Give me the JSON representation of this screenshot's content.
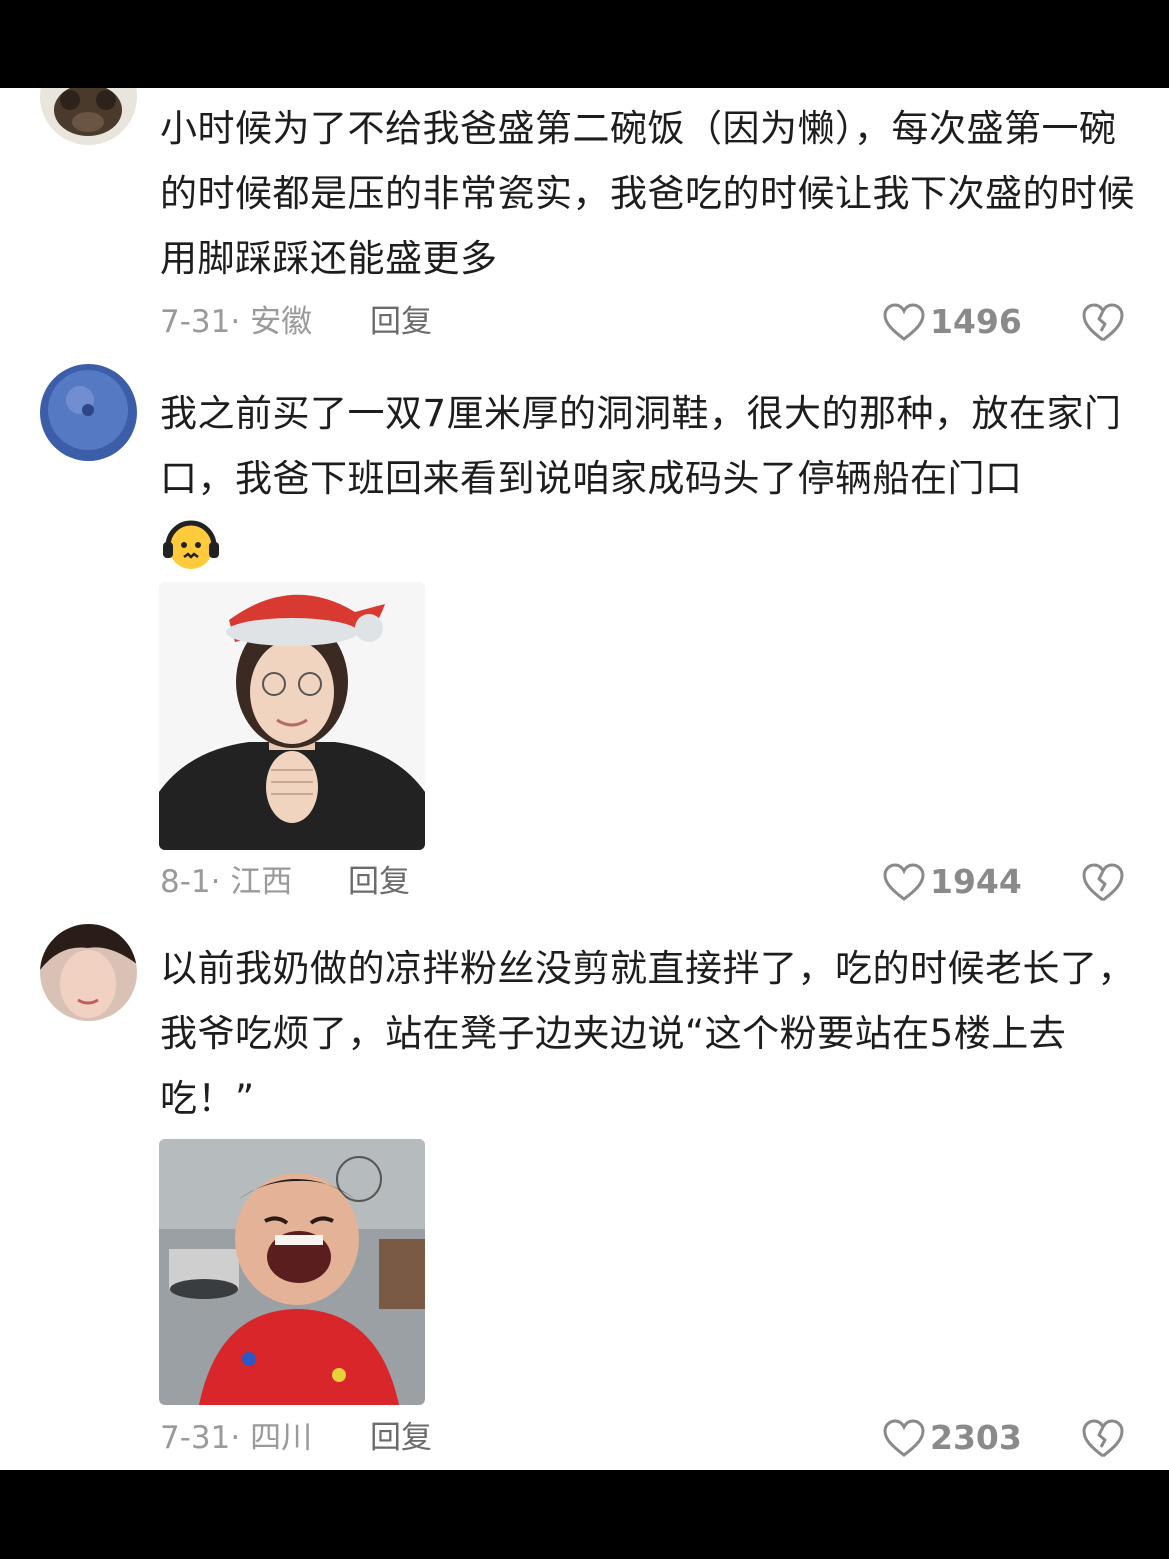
{
  "comments": [
    {
      "text": "小时候为了不给我爸盛第二碗饭（因为懒），每次盛第一碗的时候都是压的非常瓷实，我爸吃的时候让我下次盛的时候用脚踩踩还能盛更多",
      "date_location": "7-31· 安徽",
      "reply_label": "回复",
      "likes": "1496",
      "avatar_icon": "avatar-dog-icon",
      "has_image": false
    },
    {
      "text": "我之前买了一双7厘米厚的洞洞鞋，很大的那种，放在家门口，我爸下班回来看到说咱家成码头了停辆船在门口",
      "date_location": "8-1· 江西",
      "reply_label": "回复",
      "likes": "1944",
      "avatar_icon": "avatar-blueberry-icon",
      "has_emoji": true,
      "emoji_icon": "headphones-face-emoji-icon",
      "has_image": true,
      "image_icon": "woman-santa-hat-sticker"
    },
    {
      "text": "以前我奶做的凉拌粉丝没剪就直接拌了，吃的时候老长了，我爷吃烦了，站在凳子边夹边说“这个粉要站在5楼上去吃！”",
      "date_location": "7-31· 四川",
      "reply_label": "回复",
      "likes": "2303",
      "avatar_icon": "avatar-girl-icon",
      "has_image": true,
      "image_icon": "laughing-man-sticker"
    }
  ],
  "colors": {
    "text": "#1d1d1d",
    "meta": "#9a9a9a",
    "reply": "#6b6b6b",
    "background": "#ffffff",
    "frame": "#000000"
  }
}
